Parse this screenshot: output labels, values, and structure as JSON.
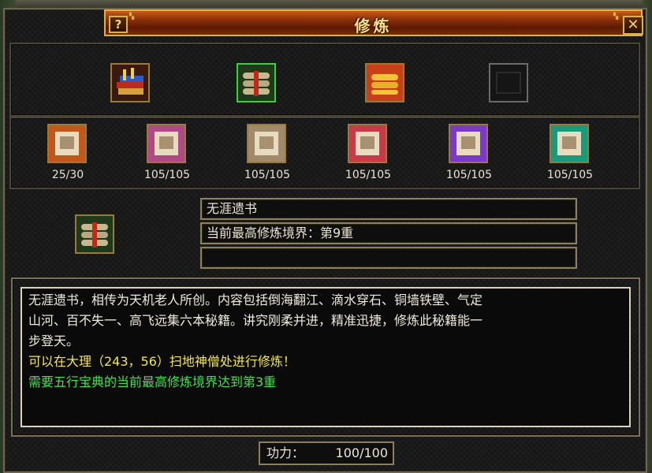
{
  "window": {
    "title": "修炼",
    "help_label": "?",
    "close_label": "✕"
  },
  "top_items": [
    {
      "icon": "book-stack-icon",
      "color": "#b04a2a"
    },
    {
      "icon": "scroll-bundle-icon",
      "color": "#3a8a2a",
      "selected": true
    },
    {
      "icon": "golden-scroll-icon",
      "color": "#d08a1a"
    },
    {
      "icon": "empty-slot-icon",
      "color": "#1a1a1a"
    }
  ],
  "skill_slots": [
    {
      "icon": "orange-scroll-icon",
      "color": "#c0581c",
      "progress": "25/30"
    },
    {
      "icon": "pink-scroll-icon",
      "color": "#b04a86",
      "progress": "105/105"
    },
    {
      "icon": "tan-scroll-icon",
      "color": "#a08a6a",
      "progress": "105/105"
    },
    {
      "icon": "red-scroll-icon",
      "color": "#c83a4a",
      "progress": "105/105"
    },
    {
      "icon": "purple-scroll-icon",
      "color": "#7a3ac8",
      "progress": "105/105"
    },
    {
      "icon": "teal-scroll-icon",
      "color": "#1a9a7a",
      "progress": "105/105"
    }
  ],
  "detail": {
    "icon": "scroll-bundle-icon",
    "name": "无涯遗书",
    "realm": "当前最高修炼境界：第9重",
    "extra": ""
  },
  "description": {
    "line1": "无涯遗书，相传为天机老人所创。内容包括倒海翻江、滴水穿石、铜墙铁壁、气定",
    "line2": "山河、百不失一、高飞远集六本秘籍。讲究刚柔并进，精准迅捷，修炼此秘籍能一",
    "line3": "步登天。",
    "location": "可以在大理（243，56）扫地神僧处进行修炼！",
    "requirement": "需要五行宝典的当前最高修炼境界达到第3重"
  },
  "power": {
    "label": "功力：",
    "value": "100/100"
  }
}
